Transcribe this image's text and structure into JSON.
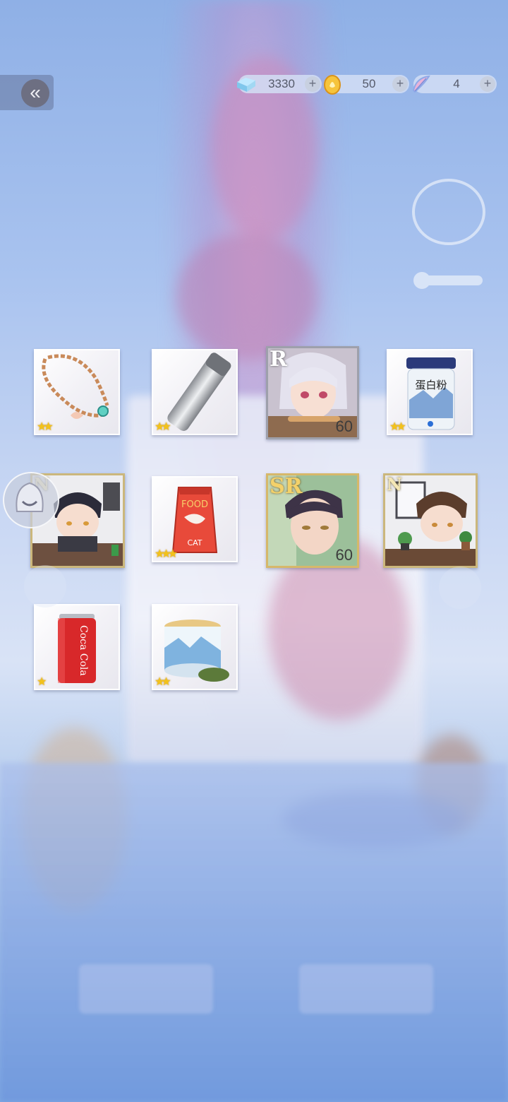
{
  "currencies": [
    {
      "icon": "diamond-icon",
      "value": "3330"
    },
    {
      "icon": "gold-coin-icon",
      "value": "50"
    },
    {
      "icon": "feather-ticket-icon",
      "value": "4"
    }
  ],
  "rewards": [
    {
      "name": "necklace",
      "stars": "★★"
    },
    {
      "name": "thermos-bottle",
      "stars": "★★"
    },
    {
      "name": "card-r-silver-hair",
      "rarity": "R",
      "level": "60"
    },
    {
      "name": "protein-powder",
      "label": "蛋白粉",
      "stars": "★★"
    },
    {
      "name": "card-n-office",
      "rarity": "N"
    },
    {
      "name": "cat-food",
      "label_top": "FOOD",
      "label_bottom": "CAT",
      "stars": "★★★"
    },
    {
      "name": "card-sr-dark-hair",
      "rarity": "SR",
      "level": "60"
    },
    {
      "name": "card-n-plants",
      "rarity": "N"
    },
    {
      "name": "coca-cola",
      "label": "Coca Cola",
      "stars": "★"
    },
    {
      "name": "tea-tin",
      "stars": "★★"
    }
  ],
  "colors": {
    "accent_gold": "#f3c21a",
    "background": "#a9c3ef"
  }
}
